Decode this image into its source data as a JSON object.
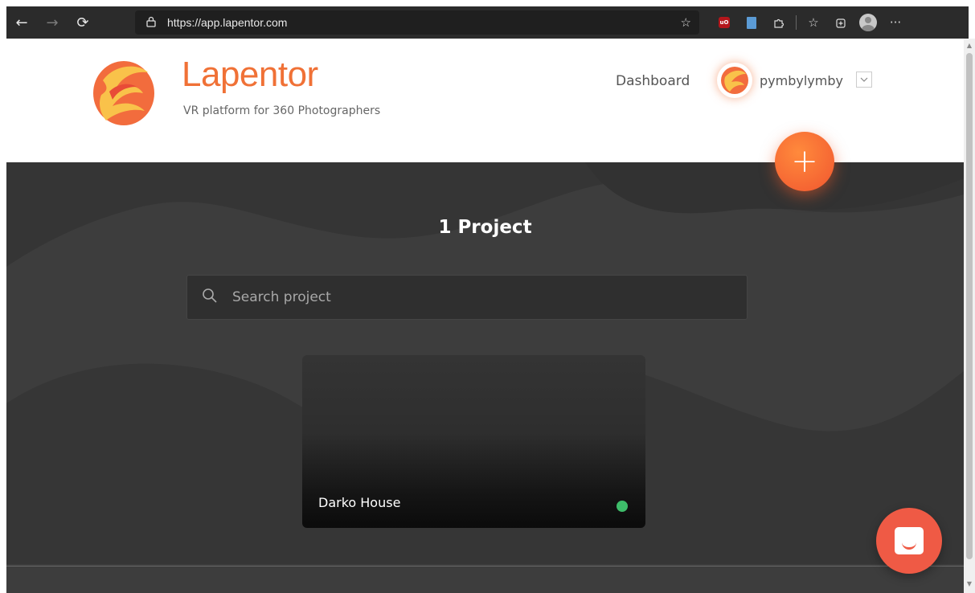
{
  "browser": {
    "url": "https://app.lapentor.com",
    "back_icon": "←",
    "forward_icon": "→",
    "refresh_icon": "⟳",
    "lock_icon": "🔒",
    "menu_icon": "···"
  },
  "header": {
    "brand_name": "Lapentor",
    "tagline": "VR platform for 360 Photographers",
    "nav_dashboard": "Dashboard",
    "username": "pymbylymby",
    "add_symbol": "+"
  },
  "main": {
    "title": "1 Project",
    "search_placeholder": "Search project",
    "projects": [
      {
        "name": "Darko House",
        "status": "published",
        "status_color": "#3ebd6a"
      }
    ]
  },
  "colors": {
    "brand": "#f07136",
    "fab": "#f1562f",
    "chat": "#ef5a45",
    "page_bg": "#3d3d3d"
  }
}
